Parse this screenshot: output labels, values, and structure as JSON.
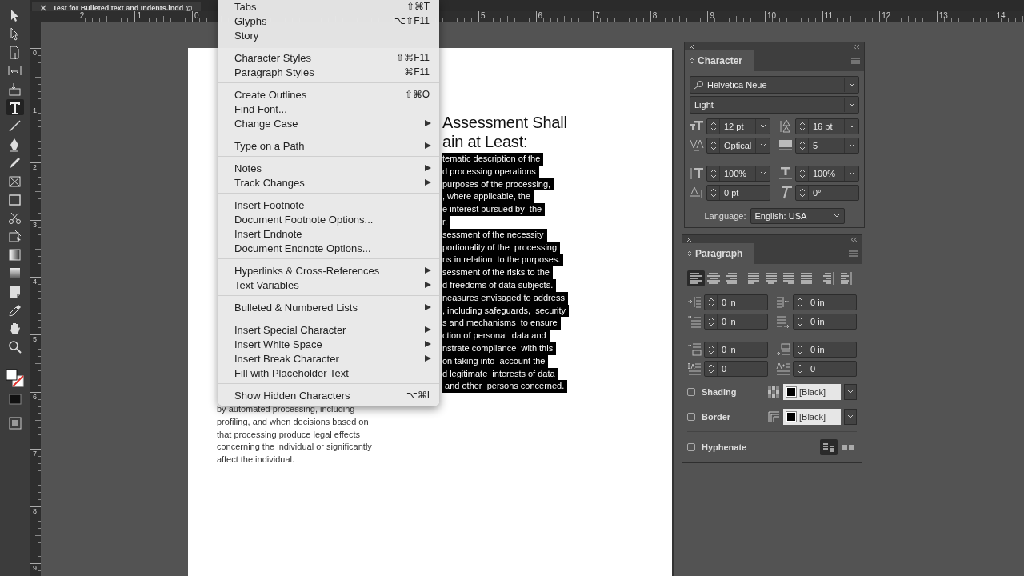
{
  "document_tab": {
    "title": "Test for Bulleted text and Indents.indd @"
  },
  "ruler": {
    "left_labels": [
      "2",
      "1",
      "0"
    ],
    "right_labels": [
      "5",
      "6",
      "7",
      "8",
      "9",
      "10",
      "11",
      "12",
      "13",
      "14"
    ],
    "vertical_labels": [
      "0",
      "1",
      "2",
      "3",
      "4",
      "5",
      "6",
      "7",
      "8",
      "9"
    ]
  },
  "tools": [
    {
      "kind": "selection",
      "selected": false
    },
    {
      "kind": "direct",
      "selected": false
    },
    {
      "kind": "page",
      "selected": false
    },
    {
      "kind": "gap",
      "selected": false
    },
    {
      "kind": "collector",
      "selected": false
    },
    {
      "kind": "type",
      "selected": true
    },
    {
      "kind": "line",
      "selected": false
    },
    {
      "kind": "pen",
      "selected": false
    },
    {
      "kind": "pencil",
      "selected": false
    },
    {
      "kind": "frame",
      "selected": false
    },
    {
      "kind": "rectangle",
      "selected": false
    },
    {
      "kind": "scissors",
      "selected": false
    },
    {
      "kind": "transform",
      "selected": false
    },
    {
      "kind": "gradient",
      "selected": false
    },
    {
      "kind": "feather",
      "selected": false
    },
    {
      "kind": "note",
      "selected": false
    },
    {
      "kind": "eyedropper",
      "selected": false
    },
    {
      "kind": "hand",
      "selected": false
    },
    {
      "kind": "zoom",
      "selected": false
    }
  ],
  "document": {
    "left_column": [
      "by automated processing, including",
      "profiling, and when decisions based on",
      "that processing produce legal effects",
      "concerning the individual or significantly",
      "affect the individual."
    ],
    "heading": [
      "Assessment Shall",
      "ain at Least:"
    ],
    "selected_lines": [
      "tematic description of the",
      "d processing operations",
      "purposes of the processing,",
      ", where applicable, the",
      "e interest pursued by  the",
      "r.",
      "sessment of the necessity",
      "portionality of the  processing",
      "ns in relation  to the purposes.",
      "sessment of the risks to the",
      "d freedoms of data subjects.",
      "neasures envisaged to address",
      ", including safeguards,  security",
      "s and mechanisms  to ensure",
      "ction of personal  data and",
      "nstrate compliance  with this",
      "on taking into  account the",
      "d legitimate  interests of data",
      " and other  persons concerned."
    ]
  },
  "menu": {
    "sections": [
      [
        {
          "label": "Tabs",
          "shortcut": "⇧⌘T",
          "submenu": false
        },
        {
          "label": "Glyphs",
          "shortcut": "⌥⇧F11",
          "submenu": false
        },
        {
          "label": "Story",
          "submenu": false
        }
      ],
      [
        {
          "label": "Character Styles",
          "shortcut": "⇧⌘F11",
          "submenu": false
        },
        {
          "label": "Paragraph Styles",
          "shortcut": "⌘F11",
          "submenu": false
        }
      ],
      [
        {
          "label": "Create Outlines",
          "shortcut": "⇧⌘O",
          "submenu": false
        },
        {
          "label": "Find Font...",
          "submenu": false
        },
        {
          "label": "Change Case",
          "submenu": true
        }
      ],
      [
        {
          "label": "Type on a Path",
          "submenu": true
        }
      ],
      [
        {
          "label": "Notes",
          "submenu": true
        },
        {
          "label": "Track Changes",
          "submenu": true
        }
      ],
      [
        {
          "label": "Insert Footnote",
          "submenu": false
        },
        {
          "label": "Document Footnote Options...",
          "submenu": false
        },
        {
          "label": "Insert Endnote",
          "submenu": false
        },
        {
          "label": "Document Endnote Options...",
          "submenu": false
        }
      ],
      [
        {
          "label": "Hyperlinks & Cross-References",
          "submenu": true
        },
        {
          "label": "Text Variables",
          "submenu": true
        }
      ],
      [
        {
          "label": "Bulleted & Numbered Lists",
          "submenu": true
        }
      ],
      [
        {
          "label": "Insert Special Character",
          "submenu": true
        },
        {
          "label": "Insert White Space",
          "submenu": true
        },
        {
          "label": "Insert Break Character",
          "submenu": true
        },
        {
          "label": "Fill with Placeholder Text",
          "submenu": false
        }
      ],
      [
        {
          "label": "Show Hidden Characters",
          "shortcut": "⌥⌘I",
          "submenu": false
        }
      ]
    ]
  },
  "character_panel": {
    "title": "Character",
    "font_family": "Helvetica Neue",
    "font_style": "Light",
    "fields": [
      {
        "kind": "size",
        "value": "12 pt",
        "dropdown": true
      },
      {
        "kind": "leading",
        "value": "16 pt",
        "dropdown": true
      },
      {
        "kind": "kerning",
        "value": "Optical",
        "dropdown": true
      },
      {
        "kind": "tracking",
        "value": "5",
        "dropdown": true
      },
      {
        "kind": "vscale",
        "value": "100%",
        "dropdown": true
      },
      {
        "kind": "hscale",
        "value": "100%",
        "dropdown": true
      },
      {
        "kind": "baseline",
        "value": "0 pt",
        "dropdown": false
      },
      {
        "kind": "skew",
        "value": "0°",
        "dropdown": false
      }
    ],
    "language_label": "Language:",
    "language": "English: USA"
  },
  "paragraph_panel": {
    "title": "Paragraph",
    "alignment": [
      {
        "kind": "left",
        "selected": true
      },
      {
        "kind": "center",
        "selected": false
      },
      {
        "kind": "right",
        "selected": false
      },
      {
        "kind": "justify-left",
        "selected": false
      },
      {
        "kind": "justify-center",
        "selected": false
      },
      {
        "kind": "justify-right",
        "selected": false
      },
      {
        "kind": "justify-all",
        "selected": false
      },
      {
        "kind": "toward-spine",
        "selected": false
      },
      {
        "kind": "away-spine",
        "selected": false
      }
    ],
    "fields": [
      {
        "kind": "left-indent",
        "value": "0 in"
      },
      {
        "kind": "right-indent",
        "value": "0 in"
      },
      {
        "kind": "first-indent",
        "value": "0 in"
      },
      {
        "kind": "last-indent",
        "value": "0 in"
      },
      {
        "kind": "space-before",
        "value": "0 in"
      },
      {
        "kind": "space-after",
        "value": "0 in"
      },
      {
        "kind": "drop-lines",
        "value": "0"
      },
      {
        "kind": "drop-chars",
        "value": "0"
      }
    ],
    "options": [
      {
        "kind": "shading",
        "label": "Shading",
        "checked": false,
        "swatch": "[Black]"
      },
      {
        "kind": "border",
        "label": "Border",
        "checked": false,
        "swatch": "[Black]"
      },
      {
        "kind": "hyphenate",
        "label": "Hyphenate",
        "checked": false
      }
    ],
    "composer": [
      {
        "kind": "single",
        "selected": true
      },
      {
        "kind": "span",
        "selected": false
      }
    ]
  }
}
